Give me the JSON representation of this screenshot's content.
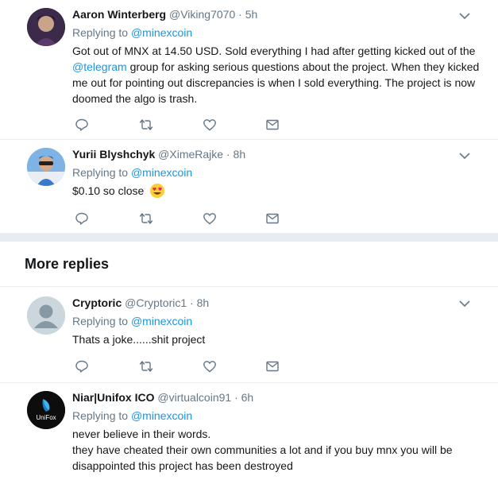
{
  "colors": {
    "accent": "#1b95e0",
    "secondary": "#657786",
    "divider": "#e6ecf0"
  },
  "section": {
    "title": "More replies"
  },
  "tweets": [
    {
      "fullname": "Aaron Winterberg",
      "handle": "@Viking7070",
      "dot": "·",
      "time": "5h",
      "replying_prefix": "Replying to ",
      "replying_to": "@minexcoin",
      "text_parts": [
        "Got out of MNX at 14.50 USD.  Sold everything I had after getting kicked out of the ",
        "@telegram",
        " group for asking serious questions about the project.  When they kicked me out for pointing out discrepancies is when I sold everything.  The project is now doomed the algo is trash."
      ]
    },
    {
      "fullname": "Yurii Blyshchyk",
      "handle": "@XimeRajke",
      "dot": "·",
      "time": "8h",
      "replying_prefix": "Replying to ",
      "replying_to": "@minexcoin",
      "text": "$0.10 so close"
    },
    {
      "fullname": "Cryptoric",
      "handle": "@Cryptoric1",
      "dot": "·",
      "time": "8h",
      "replying_prefix": "Replying to ",
      "replying_to": "@minexcoin",
      "text": "Thats a joke......shit project"
    },
    {
      "fullname": "Niar|Unifox ICO",
      "handle": "@virtualcoin91",
      "dot": "·",
      "time": "6h",
      "replying_prefix": "Replying to ",
      "replying_to": "@minexcoin",
      "avatar_label": "UniFox",
      "text_line1": "never believe in their words.",
      "text_line2": "they have cheated their own communities a lot and if you buy mnx you will be disappointed this project has been destroyed"
    }
  ],
  "icons": {
    "reply": "reply-icon",
    "retweet": "retweet-icon",
    "like": "heart-icon",
    "dm": "envelope-icon",
    "caret": "chevron-down-icon",
    "emoji": "heart-eyes-emoji-icon"
  }
}
